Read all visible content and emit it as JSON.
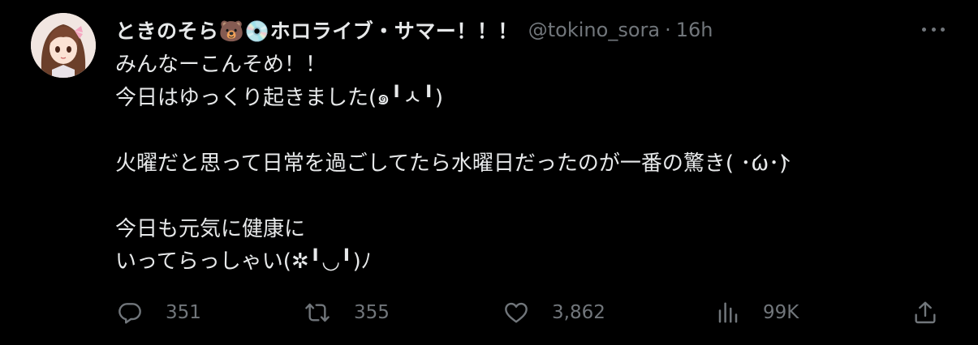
{
  "tweet": {
    "display_name": "ときのそら🐻💿ホロライブ・サマー！！！",
    "handle": "@tokino_sora",
    "separator": "·",
    "time": "16h",
    "lines": [
      "みんなーこんそめ！！",
      "今日はゆっくり起きました(๑╹ㅅ╹)",
      "",
      "火曜だと思って日常を過ごしてたら水曜日だったのが一番の驚き( ･́ω･̀)",
      "",
      "今日も元気に健康に",
      "いってらっしゃい(✲╹◡╹)ﾉ"
    ]
  },
  "actions": {
    "reply_count": "351",
    "retweet_count": "355",
    "like_count": "3,862",
    "views_count": "99K"
  },
  "icons": {
    "reply": "reply-icon",
    "retweet": "retweet-icon",
    "like": "like-icon",
    "views": "views-icon",
    "share": "share-icon",
    "more": "more-icon"
  },
  "colors": {
    "background": "#000000",
    "text": "#e7e9ea",
    "muted": "#71767b"
  }
}
